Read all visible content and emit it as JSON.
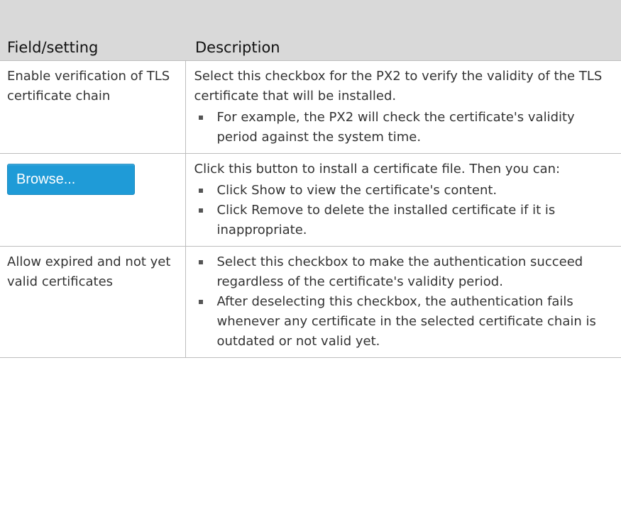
{
  "table": {
    "headers": [
      "Field/setting",
      "Description"
    ],
    "rows": [
      {
        "field": "Enable verification of TLS certificate chain",
        "description": "Select this checkbox for the PX2 to verify the validity of the TLS certificate that will be installed.",
        "bullets": [
          "For example, the PX2 will check the certificate's validity period against the system time."
        ]
      },
      {
        "field_button": "Browse...",
        "description": "Click this button to install a certificate file. Then you can:",
        "bullets": [
          "Click Show to view the certificate's content.",
          "Click Remove to delete the installed certificate if it is inappropriate."
        ]
      },
      {
        "field": "Allow expired and not yet valid certificates",
        "description": "",
        "bullets": [
          "Select this checkbox to make the authentication succeed regardless of the certificate's validity period.",
          "After deselecting this checkbox, the authentication fails whenever any certificate in the selected certificate chain is outdated or not valid yet."
        ]
      }
    ]
  },
  "colors": {
    "header_bg": "#d9d9d9",
    "border": "#bdbdbd",
    "button_bg": "#1f9bd7",
    "text": "#333333"
  },
  "icons": {
    "bullet": "square-bullet-icon"
  }
}
